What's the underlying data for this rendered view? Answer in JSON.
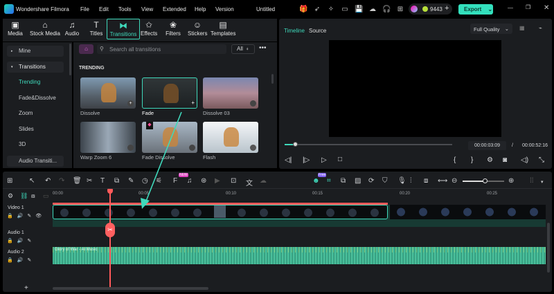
{
  "app": {
    "title": "Wondershare Filmora",
    "project": "Untitled"
  },
  "menu": [
    "File",
    "Edit",
    "Tools",
    "View",
    "Extended",
    "Help",
    "Version"
  ],
  "credits": "9443",
  "export_label": "Export",
  "tabs": [
    {
      "label": "Media",
      "icon": "media-icon"
    },
    {
      "label": "Stock Media",
      "icon": "stock-icon"
    },
    {
      "label": "Audio",
      "icon": "music-icon"
    },
    {
      "label": "Titles",
      "icon": "title-icon"
    },
    {
      "label": "Transitions",
      "icon": "transition-icon",
      "active": true
    },
    {
      "label": "Effects",
      "icon": "effects-icon"
    },
    {
      "label": "Filters",
      "icon": "filter-icon"
    },
    {
      "label": "Stickers",
      "icon": "sticker-icon"
    },
    {
      "label": "Templates",
      "icon": "template-icon"
    }
  ],
  "sidebar": {
    "items": [
      "Mine",
      "Transitions",
      "Trending",
      "Fade&Dissolve",
      "Zoom",
      "Slides",
      "3D",
      "Audio Transiti..."
    ]
  },
  "search": {
    "placeholder": "Search all transitions",
    "filter": "All"
  },
  "section": "TRENDING",
  "transitions": [
    {
      "label": "Dissolve"
    },
    {
      "label": "Fade",
      "selected": true
    },
    {
      "label": "Dissolve 03"
    },
    {
      "label": "Warp Zoom 6"
    },
    {
      "label": "Fade Dissolve",
      "premium": true
    },
    {
      "label": "Flash"
    }
  ],
  "preview": {
    "tab_timeline": "Timeline",
    "tab_source": "Source",
    "quality": "Full Quality",
    "current_time": "00:00:03:09",
    "separator": "/",
    "total_time": "00:00:52:16",
    "progress": 0.06
  },
  "ruler": [
    "00:00",
    "00:05",
    "00:10",
    "00:15",
    "00:20",
    "00:25"
  ],
  "tracks": {
    "video1": "Video 1",
    "audio1": "Audio 1",
    "audio2": "Audio 2",
    "audio_clip": "Glory of War - AI Music"
  },
  "badges": {
    "new": "NEW",
    "free": "Free"
  },
  "colors": {
    "accent": "#3fd9bb",
    "playhead": "#ff5a5a",
    "export": "#33e0bd"
  }
}
